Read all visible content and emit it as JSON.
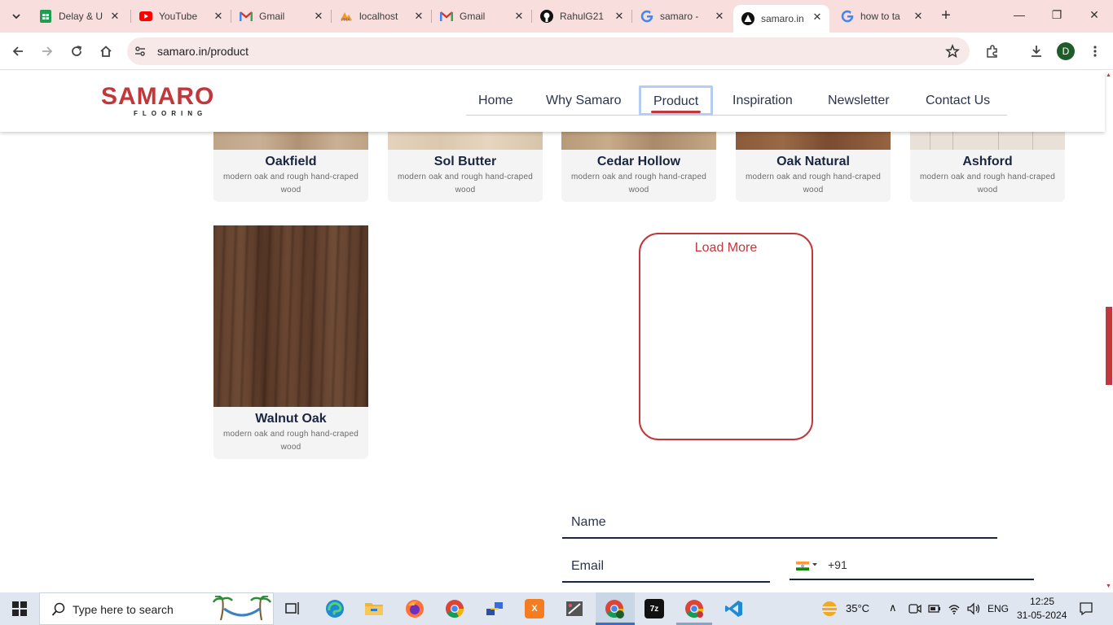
{
  "browser": {
    "tabs": [
      {
        "title": "Delay & U",
        "icon": "sheets-icon"
      },
      {
        "title": "YouTube",
        "icon": "youtube-icon"
      },
      {
        "title": "Gmail",
        "icon": "gmail-icon"
      },
      {
        "title": "localhost",
        "icon": "phpmyadmin-icon"
      },
      {
        "title": "Gmail",
        "icon": "gmail-icon"
      },
      {
        "title": "RahulG21",
        "icon": "github-icon"
      },
      {
        "title": "samaro -",
        "icon": "google-icon"
      },
      {
        "title": "samaro.in",
        "icon": "samaro-site-icon"
      },
      {
        "title": "how to ta",
        "icon": "google-icon"
      }
    ],
    "active_tab_index": 7,
    "url": "samaro.in/product",
    "profile_initial": "D"
  },
  "site": {
    "logo": {
      "brand": "SAMARO",
      "subtitle": "FLOORING"
    },
    "nav": [
      "Home",
      "Why Samaro",
      "Product",
      "Inspiration",
      "Newsletter",
      "Contact Us"
    ],
    "active_nav": "Product"
  },
  "products": [
    {
      "name": "Oakfield",
      "desc": "modern oak and rough hand-craped wood"
    },
    {
      "name": "Sol Butter",
      "desc": "modern oak and rough hand-craped wood"
    },
    {
      "name": "Cedar Hollow",
      "desc": "modern oak and rough hand-craped wood"
    },
    {
      "name": "Oak Natural",
      "desc": "modern oak and rough hand-craped wood"
    },
    {
      "name": "Ashford",
      "desc": "modern oak and rough hand-craped wood"
    },
    {
      "name": "Walnut Oak",
      "desc": "modern oak and rough hand-craped wood"
    }
  ],
  "load_more_label": "Load More",
  "form": {
    "name_placeholder": "Name",
    "email_placeholder": "Email",
    "phone_code": "+91"
  },
  "taskbar": {
    "search_placeholder": "Type here to search",
    "weather": "35°C",
    "language": "ENG",
    "time": "12:25",
    "date": "31-05-2024"
  },
  "colors": {
    "brand_red": "#c0373c",
    "navy_text": "#1a2640",
    "tab_strip": "#f9dede"
  }
}
